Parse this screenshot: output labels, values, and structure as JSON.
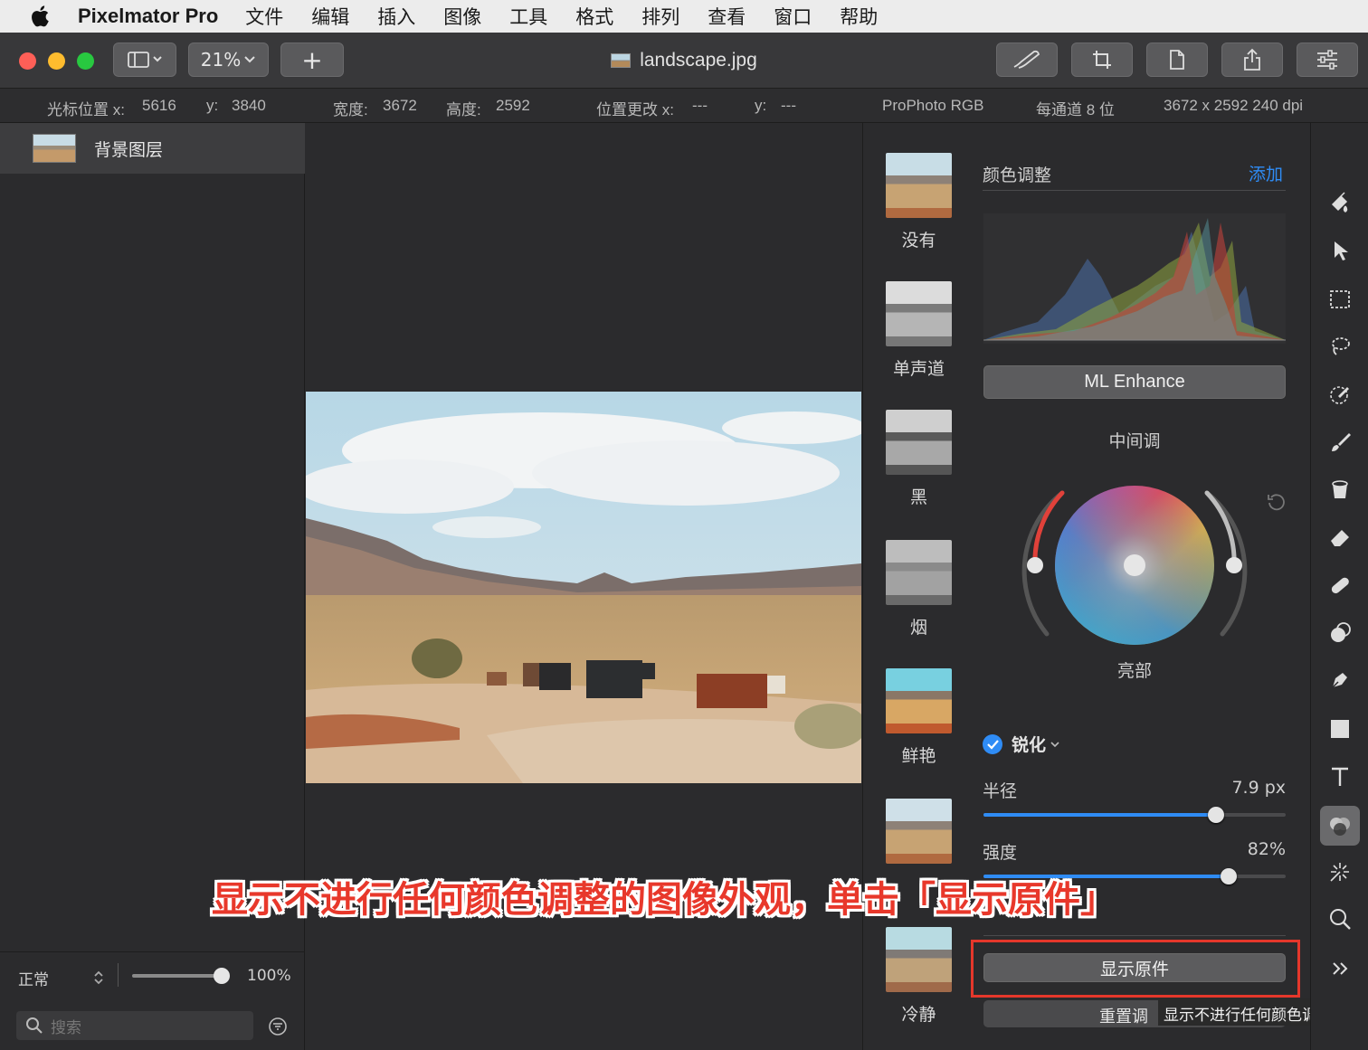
{
  "menubar": {
    "app_name": "Pixelmator Pro",
    "items": [
      "文件",
      "编辑",
      "插入",
      "图像",
      "工具",
      "格式",
      "排列",
      "查看",
      "窗口",
      "帮助"
    ]
  },
  "toolbar": {
    "zoom": "21%",
    "add_label": "+",
    "document_title": "landscape.jpg"
  },
  "infobar": {
    "cursor_x_label": "光标位置 x:",
    "cursor_x": "5616",
    "cursor_y_label": "y:",
    "cursor_y": "3840",
    "width_label": "宽度:",
    "width": "3672",
    "height_label": "高度:",
    "height": "2592",
    "pos_change_x_label": "位置更改 x:",
    "pos_change_x": "---",
    "pos_change_y_label": "y:",
    "pos_change_y": "---",
    "color_profile": "ProPhoto RGB",
    "bit_depth": "每通道 8 位",
    "dimensions": "3672 x 2592 240 dpi"
  },
  "layers": {
    "items": [
      {
        "name": "背景图层"
      }
    ],
    "blend_mode": "正常",
    "opacity": "100%",
    "opacity_value": 1.0,
    "search_placeholder": "搜索"
  },
  "presets": [
    {
      "label": "没有",
      "style": "color"
    },
    {
      "label": "单声道",
      "style": "mono"
    },
    {
      "label": "黑",
      "style": "mono"
    },
    {
      "label": "烟",
      "style": "smoke"
    },
    {
      "label": "鲜艳",
      "style": "vivid"
    },
    {
      "label": "",
      "style": "color"
    },
    {
      "label": "冷静",
      "style": "cool"
    }
  ],
  "adjust": {
    "section_title": "颜色调整",
    "add_label": "添加",
    "ml_enhance": "ML Enhance",
    "midtones_label": "中间调",
    "highlights_label": "亮部",
    "sharpen_label": "锐化",
    "radius_label": "半径",
    "radius_value": "7.9 px",
    "radius_fraction": 0.77,
    "intensity_label": "强度",
    "intensity_value": "82%",
    "intensity_fraction": 0.81,
    "show_original": "显示原件",
    "reset_label": "重置调",
    "tooltip": "显示不进行任何颜色调整的对"
  },
  "caption": "显示不进行任何颜色调整的图像外观，单击「显示原件」",
  "colors": {
    "accent": "#2f8cf5",
    "highlight_box": "#e5372b",
    "caption": "#e8382b"
  },
  "tools": [
    "paint-bucket-icon",
    "pointer-icon",
    "rect-select-icon",
    "lasso-icon",
    "color-picker-icon",
    "brush-icon",
    "fill-icon",
    "eraser-icon",
    "bandage-icon",
    "clone-icon",
    "pen-icon",
    "shape-icon",
    "text-icon",
    "color-adjust-icon",
    "effects-icon",
    "zoom-icon",
    "more-icon"
  ]
}
